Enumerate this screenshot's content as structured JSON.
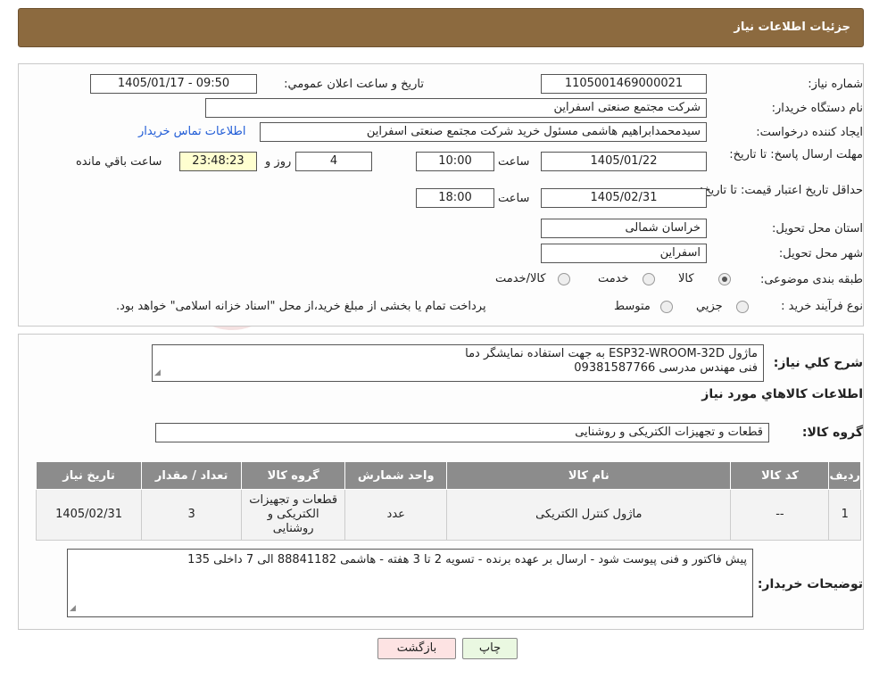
{
  "header": {
    "title": "جزئیات اطلاعات نیاز"
  },
  "watermark": {
    "text": "AriaTender.neT"
  },
  "fields": {
    "need_number_label": "شماره نیاز:",
    "need_number": "1105001469000021",
    "announce_label": "تاریخ و ساعت اعلان عمومي:",
    "announce_value": "1405/01/17 - 09:50",
    "buyer_org_label": "نام دستگاه خريدار:",
    "buyer_org": "شرکت مجتمع صنعتی اسفراین",
    "requester_label": "ايجاد کننده درخواست:",
    "requester": "سیدمحمدابراهیم هاشمی مسئول خرید شرکت مجتمع صنعتی اسفراین",
    "contact_link": "اطلاعات تماس خریدار",
    "deadline_label": "مهلت ارسال پاسخ: تا تاریخ:",
    "deadline_date": "1405/01/22",
    "time_label": "ساعت",
    "deadline_time": "10:00",
    "days_value": "4",
    "days_label": "روز و",
    "remaining_time": "23:48:23",
    "remaining_label": "ساعت باقي مانده",
    "validity_label": "حداقل تاريخ اعتبار قيمت: تا تاریخ:",
    "validity_date": "1405/02/31",
    "validity_time": "18:00",
    "province_label": "استان محل تحویل:",
    "province": "خراسان شمالی",
    "city_label": "شهر محل تحویل:",
    "city": "اسفراین",
    "category_label": "طبقه بندی موضوعی:",
    "category_options": [
      "کالا",
      "خدمت",
      "کالا/خدمت"
    ],
    "category_selected": "کالا",
    "process_label": "نوع فرآيند خريد :",
    "process_options": [
      "جزيي",
      "متوسط"
    ],
    "process_note": "پرداخت تمام یا بخشی از مبلغ خرید،از محل \"اسناد خزانه اسلامی\" خواهد بود."
  },
  "description": {
    "label": "شرح کلي نياز:",
    "lines": [
      "ماژول ESP32-WROOM-32D  به جهت استفاده نمایشگر دما",
      "فنی مهندس مدرسی 09381587766"
    ]
  },
  "goods": {
    "section_title": "اطلاعات کالاهاي مورد نياز",
    "group_label": "گروه کالا:",
    "group_value": "قطعات و تجهیزات الکتریکی و روشنایی",
    "table": {
      "headers": [
        "رديف",
        "کد کالا",
        "نام کالا",
        "واحد شمارش",
        "گروه کالا",
        "تعداد / مقدار",
        "تاريخ نياز"
      ],
      "rows": [
        [
          "1",
          "--",
          "ماژول کنترل الکتریکی",
          "عدد",
          "قطعات و تجهیزات الکتریکی و روشنایی",
          "3",
          "1405/02/31"
        ]
      ]
    }
  },
  "buyer_notes": {
    "label": "توضيحات خريدار:",
    "text": "پیش فاکتور و فنی پیوست شود - ارسال بر عهده برنده - تسویه 2 تا 3 هفته - هاشمی 88841182 الی 7 داخلی 135"
  },
  "buttons": {
    "print": "چاپ",
    "back": "بازگشت"
  },
  "colors": {
    "header_bg": "#8c6a3f",
    "table_header_bg": "#8c8c8c",
    "link": "#1f5bd6",
    "remaining_bg": "#ffffd0",
    "back_btn_bg": "#fde3e3",
    "print_btn_bg": "#eaf8e1"
  }
}
